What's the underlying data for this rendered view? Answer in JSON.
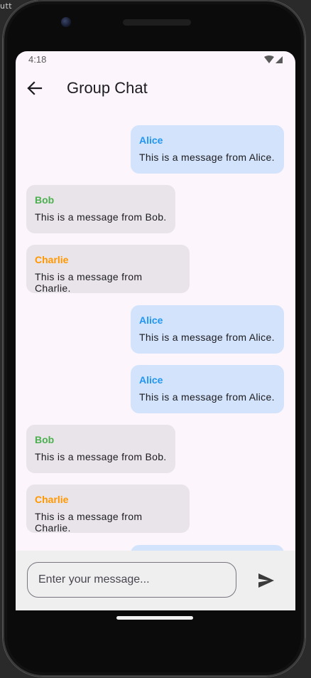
{
  "host": {
    "corner_text": "utt"
  },
  "status_bar": {
    "time": "4:18"
  },
  "app_bar": {
    "title": "Group Chat"
  },
  "colors": {
    "alice": "#2196f3",
    "bob": "#4caf50",
    "charlie": "#ff9800",
    "my_bubble": "#d2e3fb",
    "other_bubble": "#e9e4e9"
  },
  "messages": [
    {
      "sender": "Alice",
      "text": "This is a message from Alice.",
      "mine": true
    },
    {
      "sender": "Bob",
      "text": "This is a message from Bob.",
      "mine": false
    },
    {
      "sender": "Charlie",
      "text": "This is a message from Charlie.",
      "mine": false
    },
    {
      "sender": "Alice",
      "text": "This is a message from Alice.",
      "mine": true
    },
    {
      "sender": "Alice",
      "text": "This is a message from Alice.",
      "mine": true
    },
    {
      "sender": "Bob",
      "text": "This is a message from Bob.",
      "mine": false
    },
    {
      "sender": "Charlie",
      "text": "This is a message from Charlie.",
      "mine": false
    }
  ],
  "composer": {
    "placeholder": "Enter your message...",
    "value": ""
  }
}
